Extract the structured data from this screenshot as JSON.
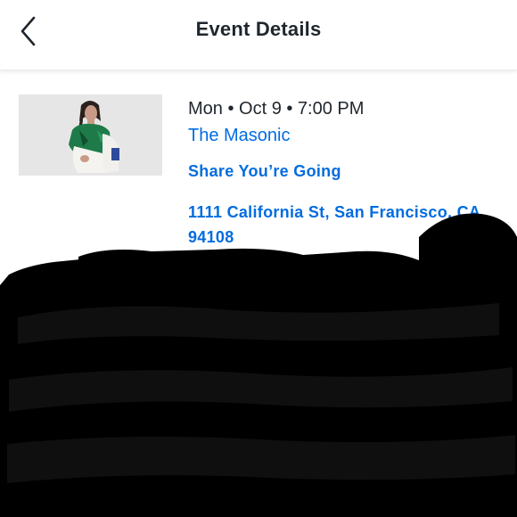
{
  "header": {
    "title": "Event Details",
    "back_icon": "chevron-left-icon"
  },
  "event": {
    "datetime": "Mon • Oct 9 • 7:00 PM",
    "venue": "The Masonic",
    "share_label": "Share You’re Going",
    "address": "1111 California St, San Francisco, CA, 94108"
  },
  "colors": {
    "link": "#026cdf",
    "text": "#1f262d",
    "card_border": "#6a3ec0",
    "redaction": "#000000"
  }
}
